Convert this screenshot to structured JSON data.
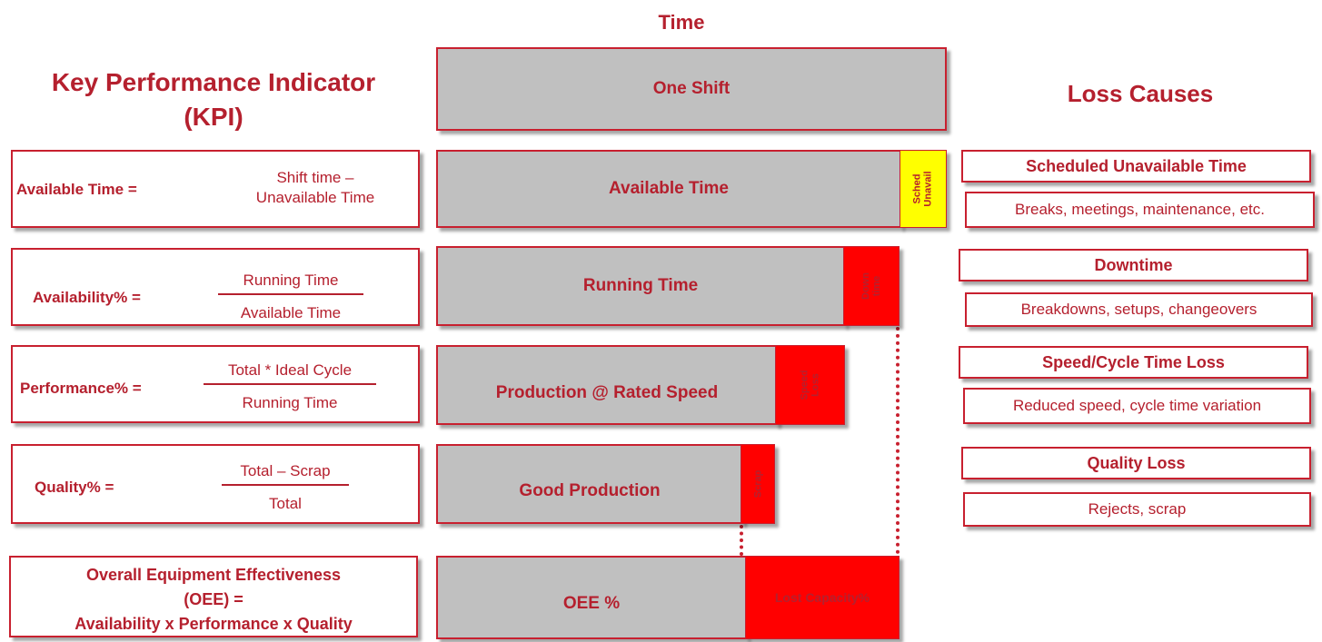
{
  "headings": {
    "time": "Time",
    "kpi_line1": "Key Performance Indicator",
    "kpi_line2": "(KPI)",
    "loss_causes": "Loss Causes"
  },
  "kpi": {
    "available": {
      "lhs": "Available Time =",
      "line1": "Shift time –",
      "line2": "Unavailable Time"
    },
    "availability": {
      "lhs": "Availability% =",
      "numerator": "Running Time",
      "denominator": "Available Time"
    },
    "performance": {
      "lhs": "Performance% =",
      "numerator": "Total * Ideal Cycle",
      "denominator": "Running Time"
    },
    "quality": {
      "lhs": "Quality% =",
      "numerator": "Total – Scrap",
      "denominator": "Total"
    },
    "oee": {
      "line1": "Overall Equipment Effectiveness",
      "line2": "(OEE) =",
      "line3": "Availability x Performance x Quality"
    }
  },
  "bars": {
    "one_shift": "One Shift",
    "available_time": "Available Time",
    "sched_unavail": "Sched\nUnavail",
    "running_time": "Running Time",
    "down_time": "Down\ntime",
    "production_rated": "Production @ Rated Speed",
    "speed_loss": "Speed\nLoss",
    "good_production": "Good Production",
    "scrap": "Scrap",
    "oee_pct": "OEE %",
    "lost_capacity": "Lost Capacity%"
  },
  "loss_causes": {
    "scheduled_title": "Scheduled Unavailable Time",
    "scheduled_desc": "Breaks, meetings, maintenance, etc.",
    "downtime_title": "Downtime",
    "downtime_desc": "Breakdowns, setups, changeovers",
    "speed_title": "Speed/Cycle Time Loss",
    "speed_desc": "Reduced speed, cycle time variation",
    "quality_title": "Quality Loss",
    "quality_desc": "Rejects, scrap"
  },
  "colors": {
    "accent_red": "#b5202e",
    "bar_gray": "#c0c0c0",
    "loss_red": "#ff0000",
    "sched_yellow": "#ffff00"
  }
}
